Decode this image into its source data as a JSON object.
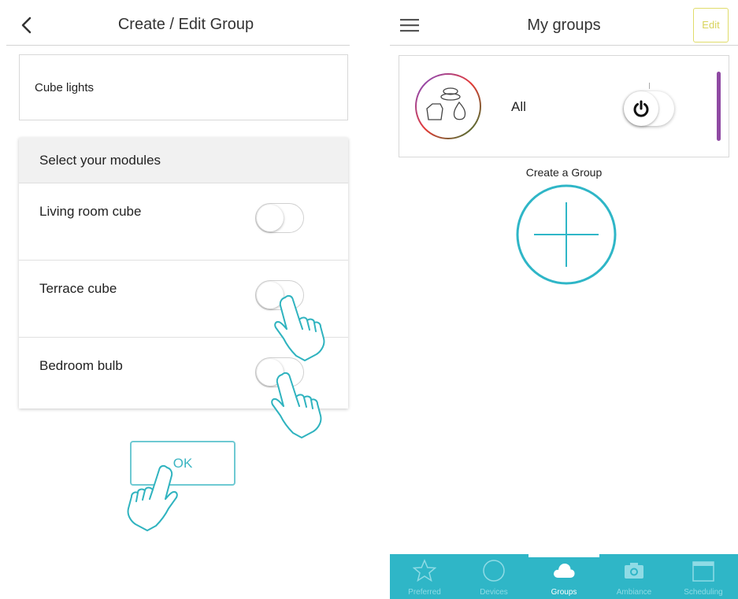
{
  "left_screen": {
    "header": {
      "title": "Create / Edit Group",
      "back_icon": "chevron-left-icon"
    },
    "group_name": {
      "value": "Cube lights"
    },
    "modules": {
      "title": "Select your modules",
      "items": [
        {
          "label": "Living room cube",
          "enabled": false
        },
        {
          "label": "Terrace cube",
          "enabled": false
        },
        {
          "label": "Bedroom bulb",
          "enabled": false
        }
      ]
    },
    "ok_label": "OK",
    "hand_icon": "tap-hand-icon"
  },
  "right_screen": {
    "header": {
      "title": "My groups",
      "menu_icon": "hamburger-menu-icon",
      "edit_label": "Edit"
    },
    "groups": [
      {
        "name": "All",
        "icon": "group-lamps-icon",
        "power": "on",
        "accent_color": "#8f4aa3"
      }
    ],
    "create_label": "Create a Group",
    "create_icon": "plus-circle-icon",
    "tabs": [
      {
        "label": "Preferred",
        "icon": "star-icon",
        "active": false
      },
      {
        "label": "Devices",
        "icon": "circle-icon",
        "active": false
      },
      {
        "label": "Groups",
        "icon": "cloud-icon",
        "active": true
      },
      {
        "label": "Ambiance",
        "icon": "camera-icon",
        "active": false
      },
      {
        "label": "Scheduling",
        "icon": "calendar-icon",
        "active": false
      }
    ]
  },
  "colors": {
    "accent_teal": "#2fb6c7",
    "ok_border": "#6ec9d2",
    "edit_border": "#e0dc6a",
    "group_bar": "#8f4aa3"
  }
}
